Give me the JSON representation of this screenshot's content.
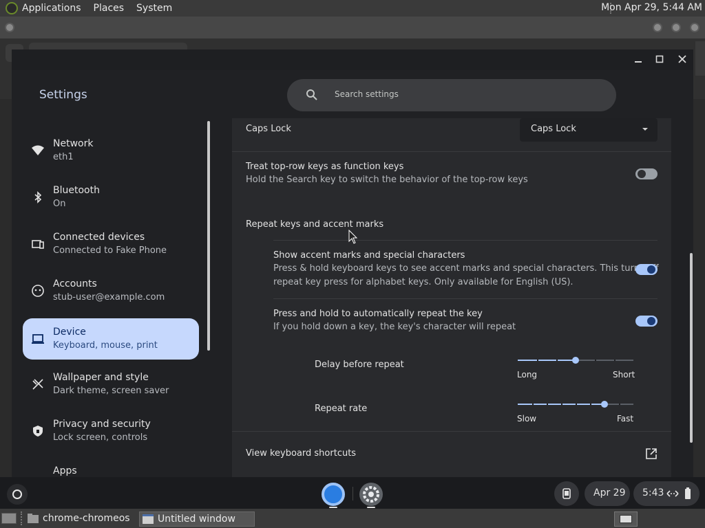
{
  "gnome_panel": {
    "menus": [
      "Applications",
      "Places",
      "System"
    ],
    "clock": "Mon Apr 29,  5:44 AM"
  },
  "settings": {
    "title": "Settings",
    "search_placeholder": "Search settings",
    "nav": [
      {
        "label": "Network",
        "sub": "eth1",
        "icon": "wifi-icon"
      },
      {
        "label": "Bluetooth",
        "sub": "On",
        "icon": "bluetooth-icon"
      },
      {
        "label": "Connected devices",
        "sub": "Connected to Fake Phone",
        "icon": "connected-devices-icon"
      },
      {
        "label": "Accounts",
        "sub": "stub-user@example.com",
        "icon": "accounts-icon"
      },
      {
        "label": "Device",
        "sub": "Keyboard, mouse, print",
        "icon": "laptop-icon"
      },
      {
        "label": "Wallpaper and style",
        "sub": "Dark theme, screen saver",
        "icon": "palette-icon"
      },
      {
        "label": "Privacy and security",
        "sub": "Lock screen, controls",
        "icon": "shield-icon"
      },
      {
        "label": "Apps",
        "sub": "",
        "icon": "apps-icon"
      }
    ],
    "active_nav": "Device",
    "caps_lock": {
      "label": "Caps Lock",
      "value": "Caps Lock"
    },
    "top_row": {
      "label": "Treat top-row keys as function keys",
      "sub": "Hold the Search key to switch the behavior of the top-row keys",
      "enabled": false
    },
    "repeat_heading": "Repeat keys and accent marks",
    "accent": {
      "label": "Show accent marks and special characters",
      "sub1": "Press & hold keyboard keys to see accent marks and special characters. This turns off",
      "sub2": "repeat key press for alphabet keys. Only available for English (US).",
      "enabled": true
    },
    "auto_repeat": {
      "label": "Press and hold to automatically repeat the key",
      "sub": "If you hold down a key, the key's character will repeat",
      "enabled": true
    },
    "delay": {
      "label": "Delay before repeat",
      "min_label": "Long",
      "max_label": "Short",
      "value": 0.5
    },
    "rate": {
      "label": "Repeat rate",
      "min_label": "Slow",
      "max_label": "Fast",
      "value": 0.75
    },
    "shortcuts": {
      "label": "View keyboard shortcuts"
    }
  },
  "shelf": {
    "date": "Apr 29",
    "time": "5:43"
  },
  "taskbar": {
    "items": [
      "chrome-chromeos",
      "Untitled window"
    ]
  },
  "colors": {
    "accent": "#a8c7fa",
    "active_nav": "#c6d8fd"
  }
}
